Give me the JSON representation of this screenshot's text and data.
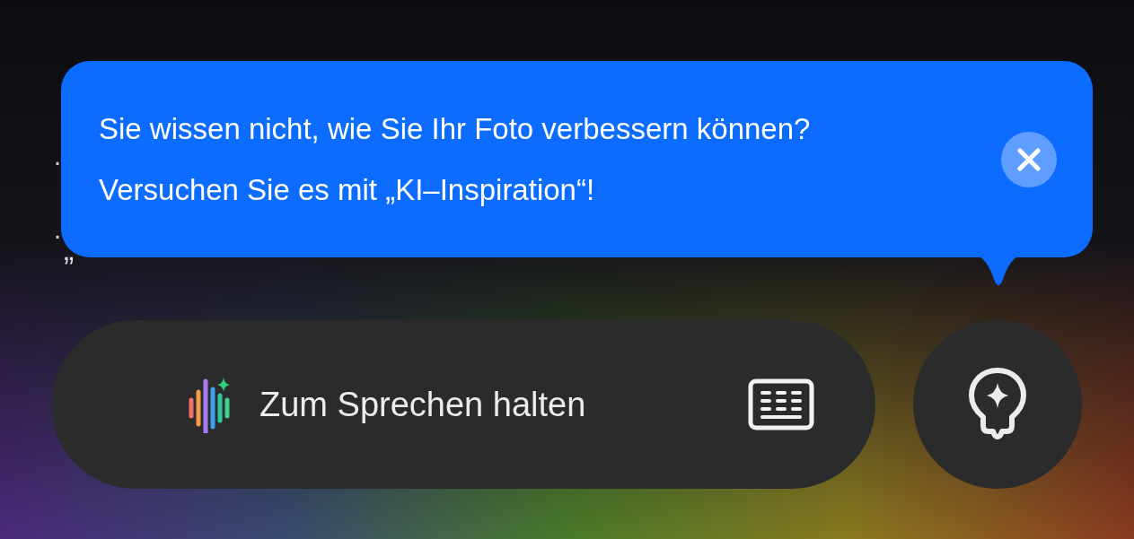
{
  "background_list": {
    "items": [
      {
        "bullet": "·"
      },
      {
        "bullet": "·",
        "text_fragment": "„"
      }
    ]
  },
  "tooltip": {
    "message": "Sie wissen nicht, wie Sie Ihr Foto verbessern können? Versuchen Sie es mit „KI–Inspiration“!"
  },
  "voice_bar": {
    "label": "Zum Sprechen halten"
  }
}
